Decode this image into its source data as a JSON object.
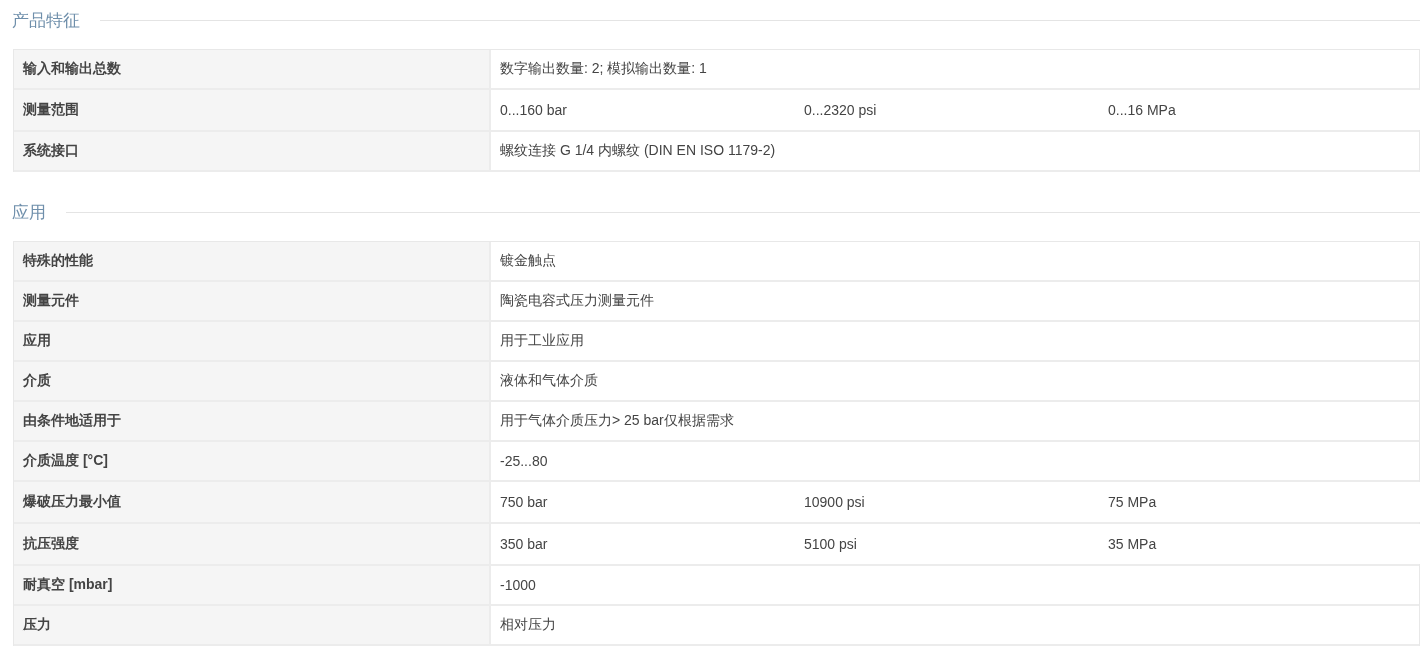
{
  "sections": [
    {
      "title": "产品特征",
      "rows": [
        {
          "label": "输入和输出总数",
          "values": [
            "数字输出数量: 2; 模拟输出数量: 1"
          ]
        },
        {
          "label": "测量范围",
          "values": [
            "0...160 bar",
            "0...2320 psi",
            "0...16 MPa"
          ]
        },
        {
          "label": "系统接口",
          "values": [
            "螺纹连接 G 1/4 内螺纹 (DIN EN ISO 1179-2)"
          ]
        }
      ]
    },
    {
      "title": "应用",
      "rows": [
        {
          "label": "特殊的性能",
          "values": [
            "镀金触点"
          ]
        },
        {
          "label": "测量元件",
          "values": [
            "陶瓷电容式压力测量元件"
          ]
        },
        {
          "label": "应用",
          "values": [
            "用于工业应用"
          ]
        },
        {
          "label": "介质",
          "values": [
            "液体和气体介质"
          ]
        },
        {
          "label": "由条件地适用于",
          "values": [
            "用于气体介质压力> 25 bar仅根据需求"
          ]
        },
        {
          "label": "介质温度 [°C]",
          "values": [
            "-25...80"
          ]
        },
        {
          "label": "爆破压力最小值",
          "values": [
            "750 bar",
            "10900 psi",
            "75 MPa"
          ]
        },
        {
          "label": "抗压强度",
          "values": [
            "350 bar",
            "5100 psi",
            "35 MPa"
          ]
        },
        {
          "label": "耐真空 [mbar]",
          "values": [
            "-1000"
          ]
        },
        {
          "label": "压力",
          "values": [
            "相对压力"
          ]
        }
      ]
    }
  ]
}
